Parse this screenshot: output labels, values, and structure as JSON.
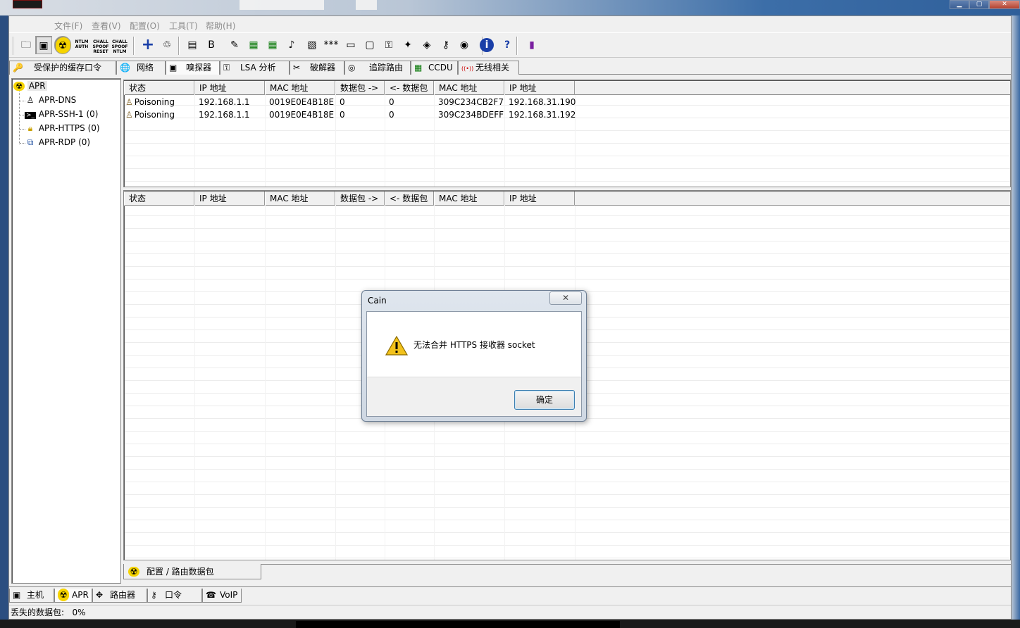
{
  "menu": [
    "文件(F)",
    "查看(V)",
    "配置(O)",
    "工具(T)",
    "帮助(H)"
  ],
  "toolbar_icons": [
    {
      "name": "open-folder-icon",
      "glyph": "🗀"
    },
    {
      "name": "sniffer-icon",
      "glyph": "▣"
    },
    {
      "name": "apr-radiation-icon",
      "glyph": "☢"
    },
    {
      "name": "ntlm-auth-icon",
      "text": "NTLM AUTH"
    },
    {
      "name": "chall-spoof-reset-icon",
      "text": "CHALL SPOOF RESET"
    },
    {
      "name": "chall-spoof-ntlm-icon",
      "text": "CHALL SPOOF NTLM"
    },
    {
      "name": "add-icon",
      "glyph": "+"
    },
    {
      "name": "recycle-icon",
      "glyph": "♲"
    },
    {
      "name": "certificate-icon",
      "glyph": "▤"
    },
    {
      "name": "base64-icon",
      "glyph": "B"
    },
    {
      "name": "hash-tool-icon",
      "glyph": "✎"
    },
    {
      "name": "router-icon",
      "glyph": "▦"
    },
    {
      "name": "vnc-icon",
      "glyph": "▦"
    },
    {
      "name": "wireless-key-icon",
      "glyph": "♪"
    },
    {
      "name": "packet-icon",
      "glyph": "▧"
    },
    {
      "name": "password-stars-icon",
      "glyph": "***"
    },
    {
      "name": "network-card-icon",
      "glyph": "▭"
    },
    {
      "name": "screen-icon",
      "glyph": "▢"
    },
    {
      "name": "lock-icon",
      "glyph": "⚿"
    },
    {
      "name": "hook-icon",
      "glyph": "✦"
    },
    {
      "name": "cable-icon",
      "glyph": "◈"
    },
    {
      "name": "key-icon",
      "glyph": "⚷"
    },
    {
      "name": "wifi-icon",
      "glyph": "◉"
    },
    {
      "name": "info-icon",
      "glyph": "i"
    },
    {
      "name": "help-icon",
      "glyph": "?"
    },
    {
      "name": "exit-icon",
      "glyph": "▮"
    }
  ],
  "tabs": [
    {
      "label": "受保护的缓存口令",
      "icon": "🔑"
    },
    {
      "label": "网络",
      "icon": "🌐"
    },
    {
      "label": "嗅探器",
      "icon": "▣"
    },
    {
      "label": "LSA 分析",
      "icon": "⚿"
    },
    {
      "label": "破解器",
      "icon": "✂"
    },
    {
      "label": "追踪路由",
      "icon": "◎"
    },
    {
      "label": "CCDU",
      "icon": "▦"
    },
    {
      "label": "无线相关",
      "icon": "((•))"
    }
  ],
  "tree": {
    "root": "APR",
    "items": [
      "APR-DNS",
      "APR-SSH-1 (0)",
      "APR-HTTPS (0)",
      "APR-RDP (0)"
    ]
  },
  "columns": [
    "状态",
    "IP 地址",
    "MAC 地址",
    "数据包 ->",
    "<- 数据包",
    "MAC 地址",
    "IP 地址"
  ],
  "rows": [
    [
      "Poisoning",
      "192.168.1.1",
      "0019E0E4B18E",
      "0",
      "0",
      "309C234CB2F7",
      "192.168.31.190"
    ],
    [
      "Poisoning",
      "192.168.1.1",
      "0019E0E4B18E",
      "0",
      "0",
      "309C234BDEFF",
      "192.168.31.192"
    ]
  ],
  "bottom_tab": "配置 / 路由数据包",
  "main_tabs": [
    {
      "label": "主机",
      "icon": "▣"
    },
    {
      "label": "APR",
      "icon": "☢"
    },
    {
      "label": "路由器",
      "icon": "✥"
    },
    {
      "label": "口令",
      "icon": "⚷"
    },
    {
      "label": "VoIP",
      "icon": "☎"
    }
  ],
  "status": "丢失的数据包:   0%",
  "dialog": {
    "title": "Cain",
    "close": "✕",
    "message": "无法合并 HTTPS 接收器 socket",
    "ok": "确定"
  }
}
